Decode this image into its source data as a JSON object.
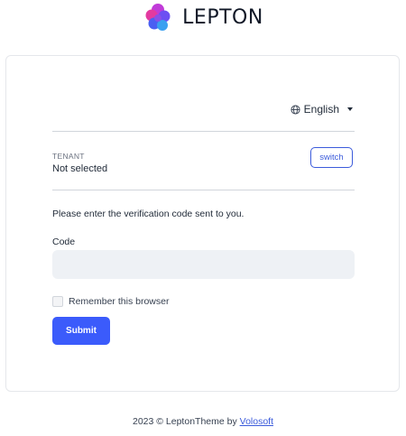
{
  "brand": {
    "name": "LEPTON",
    "logo_icon": "lepton-logo-icon"
  },
  "language": {
    "selected": "English",
    "icon": "globe-icon"
  },
  "tenant": {
    "label": "TENANT",
    "value": "Not selected",
    "switch_label": "switch"
  },
  "form": {
    "message": "Please enter the verification code sent to you.",
    "code_label": "Code",
    "code_value": "",
    "remember_label": "Remember this browser",
    "remember_checked": false,
    "submit_label": "Submit"
  },
  "footer": {
    "prefix": "2023 © LeptonTheme by",
    "link": "Volosoft"
  },
  "colors": {
    "primary": "#3b5bfb",
    "input_bg": "#eef1f5",
    "border": "#e5e7eb"
  }
}
